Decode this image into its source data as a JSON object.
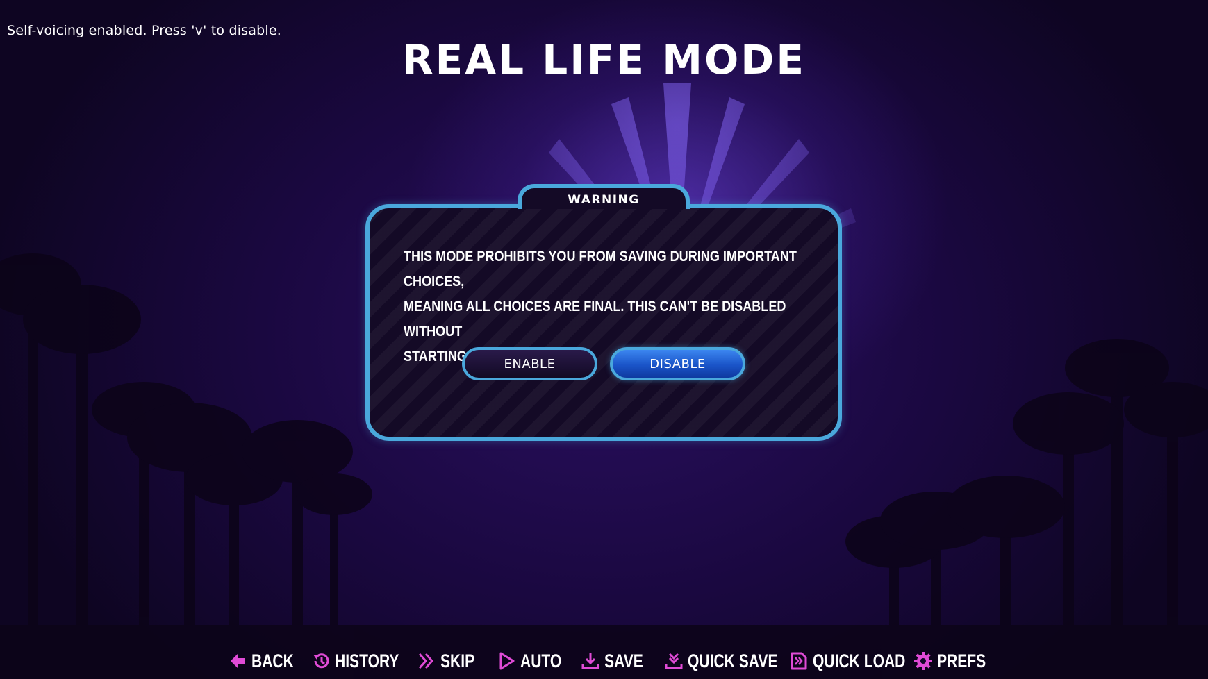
{
  "status": {
    "text": "Self-voicing enabled. Press 'v' to disable."
  },
  "screen": {
    "title": "REAL LIFE MODE"
  },
  "dialog": {
    "tab_label": "WARNING",
    "message": "This mode prohibits you from saving during important choices,\nmeaning all choices are final. This can't be disabled without\nstarting a new game.",
    "enable_label": "ENABLE",
    "disable_label": "DISABLE",
    "selected": "DISABLE"
  },
  "nav": {
    "items": [
      {
        "label": "BACK",
        "icon": "arrow-left-icon"
      },
      {
        "label": "HISTORY",
        "icon": "history-icon"
      },
      {
        "label": "SKIP",
        "icon": "skip-icon"
      },
      {
        "label": "AUTO",
        "icon": "play-icon"
      },
      {
        "label": "SAVE",
        "icon": "download-icon"
      },
      {
        "label": "QUICK SAVE",
        "icon": "quick-save-icon"
      },
      {
        "label": "QUICK LOAD",
        "icon": "quick-load-icon"
      },
      {
        "label": "PREFS",
        "icon": "gear-icon"
      }
    ]
  },
  "colors": {
    "accent": "#4aa8dc",
    "icon": "#e04bd6",
    "button_selected": "#1a54c8",
    "background": "#1a0840"
  }
}
